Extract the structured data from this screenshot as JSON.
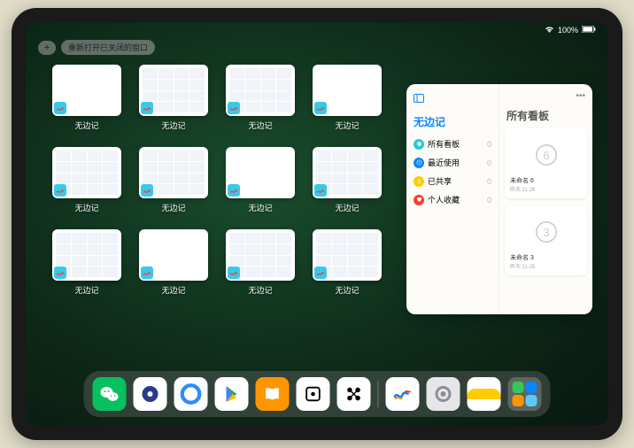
{
  "status": {
    "battery": "100%",
    "signal_icon": "wifi-icon"
  },
  "top": {
    "reopen_label": "重新打开已关闭的窗口"
  },
  "apps": {
    "label": "无边记",
    "thumbs": [
      {
        "style": "blank"
      },
      {
        "style": "cal"
      },
      {
        "style": "cal"
      },
      {
        "style": "blank"
      },
      {
        "style": "cal"
      },
      {
        "style": "cal"
      },
      {
        "style": "blank"
      },
      {
        "style": "cal"
      },
      {
        "style": "cal"
      },
      {
        "style": "blank"
      },
      {
        "style": "cal"
      },
      {
        "style": "cal"
      }
    ]
  },
  "panel": {
    "left_title": "无边记",
    "right_title": "所有看板",
    "items": [
      {
        "label": "所有看板",
        "count": "0",
        "color": "#28c8d8"
      },
      {
        "label": "最近使用",
        "count": "0",
        "color": "#0a84ff"
      },
      {
        "label": "已共享",
        "count": "0",
        "color": "#ffcc00"
      },
      {
        "label": "个人收藏",
        "count": "0",
        "color": "#ff3b30"
      }
    ],
    "boards": [
      {
        "title": "未命名 6",
        "time": "昨天 11:26",
        "digit": "6"
      },
      {
        "title": "未命名 3",
        "time": "昨天 11:25",
        "digit": "3"
      }
    ]
  },
  "dock": {
    "icons": [
      {
        "name": "wechat",
        "bg": "#07c160"
      },
      {
        "name": "quark",
        "bg": "#fff"
      },
      {
        "name": "qq-browser",
        "bg": "#fff"
      },
      {
        "name": "play",
        "bg": "#fff"
      },
      {
        "name": "books",
        "bg": "#ff9500"
      },
      {
        "name": "dice",
        "bg": "#fff"
      },
      {
        "name": "connect",
        "bg": "#fff"
      },
      {
        "name": "freeform",
        "bg": "#fff"
      },
      {
        "name": "settings",
        "bg": "#e5e5ea"
      },
      {
        "name": "notes",
        "bg": "#fff"
      },
      {
        "name": "app-library",
        "bg": "rgba(255,255,255,0.2)"
      }
    ]
  }
}
